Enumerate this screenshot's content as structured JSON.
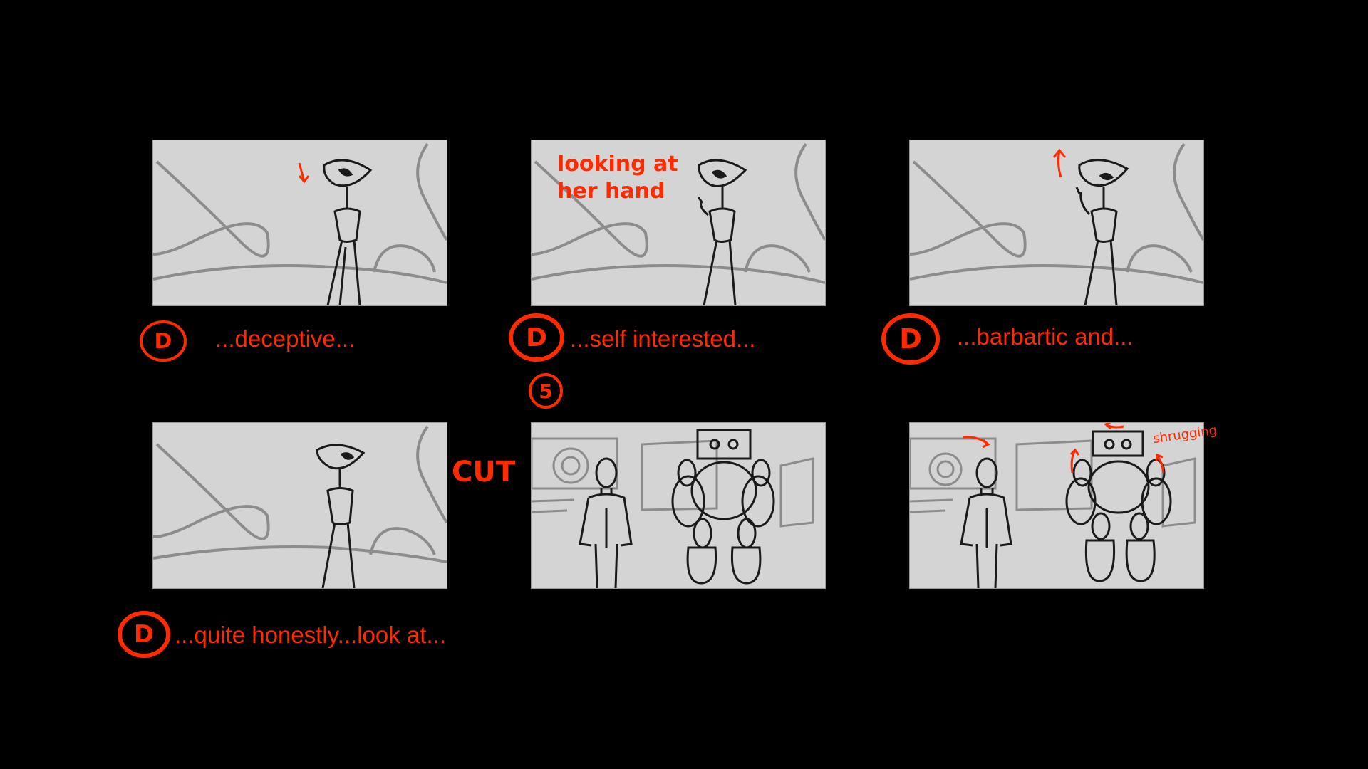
{
  "panels": [
    {
      "caption": "...deceptive...",
      "marker": "D",
      "note": ""
    },
    {
      "caption": "...self interested...",
      "marker": "D",
      "note_line1": "looking at",
      "note_line2": "her hand"
    },
    {
      "caption": "...barbartic and...",
      "marker": "D"
    },
    {
      "caption": "...quite honestly...look at...",
      "marker": "D"
    },
    {
      "shot_number": "5",
      "transition": "CUT"
    },
    {
      "note": "shrugging"
    }
  ],
  "colors": {
    "accent": "#ff2a00",
    "panel_bg": "#d4d4d4",
    "sketch": "#8c8c8c",
    "ink": "#1a1a1a",
    "page_bg": "#000000"
  }
}
